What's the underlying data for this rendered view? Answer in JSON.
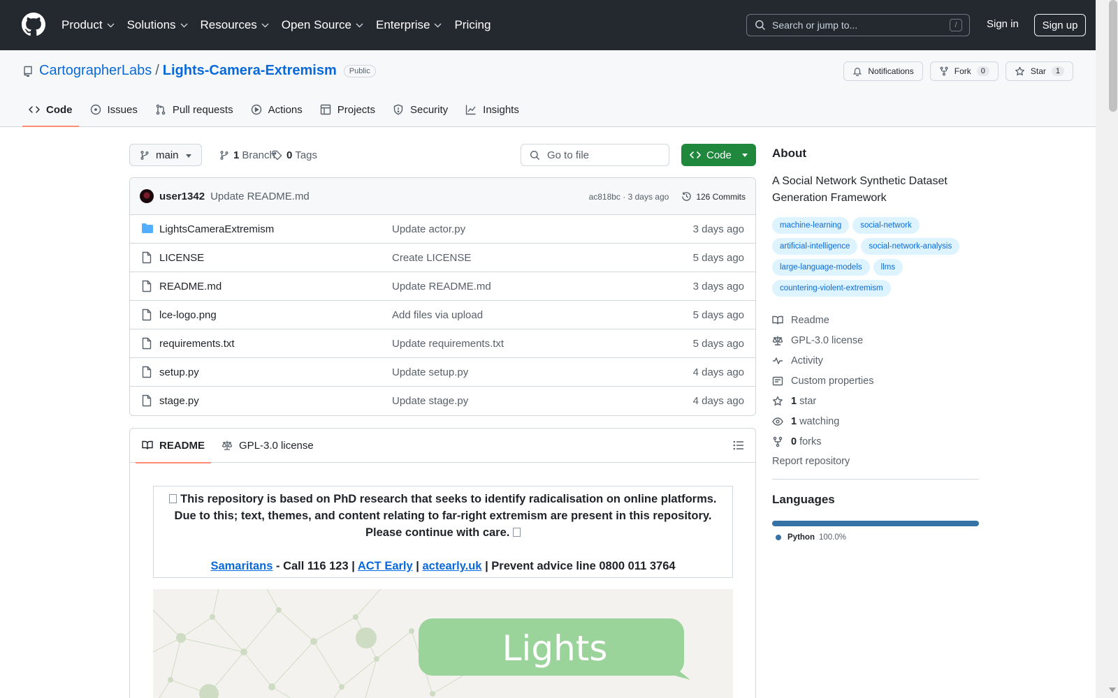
{
  "header": {
    "nav": [
      {
        "label": "Product",
        "dropdown": true
      },
      {
        "label": "Solutions",
        "dropdown": true
      },
      {
        "label": "Resources",
        "dropdown": true
      },
      {
        "label": "Open Source",
        "dropdown": true
      },
      {
        "label": "Enterprise",
        "dropdown": true
      },
      {
        "label": "Pricing",
        "dropdown": false
      }
    ],
    "search_placeholder": "Search or jump to...",
    "search_shortcut": "/",
    "sign_in": "Sign in",
    "sign_up": "Sign up"
  },
  "repo": {
    "owner": "CartographerLabs",
    "separator": "/",
    "name": "Lights-Camera-Extremism",
    "visibility": "Public",
    "buttons": {
      "notifications": "Notifications",
      "fork": "Fork",
      "fork_count": "0",
      "star": "Star",
      "star_count": "1"
    },
    "tabs": [
      {
        "label": "Code",
        "icon": "code-icon",
        "active": true
      },
      {
        "label": "Issues",
        "icon": "issue-icon",
        "active": false
      },
      {
        "label": "Pull requests",
        "icon": "pull-request-icon",
        "active": false
      },
      {
        "label": "Actions",
        "icon": "play-icon",
        "active": false
      },
      {
        "label": "Projects",
        "icon": "table-icon",
        "active": false
      },
      {
        "label": "Security",
        "icon": "shield-icon",
        "active": false
      },
      {
        "label": "Insights",
        "icon": "graph-icon",
        "active": false
      }
    ]
  },
  "toolbar": {
    "branch": "main",
    "branch_count": "1",
    "branch_label": "Branch",
    "tag_count": "0",
    "tag_label": "Tags",
    "go_to_file": "Go to file",
    "code_button": "Code"
  },
  "commit": {
    "user": "user1342",
    "message": "Update README.md",
    "sha_time": "ac818bc · 3 days ago",
    "commits": "126 Commits"
  },
  "files": [
    {
      "name": "LightsCameraExtremism",
      "type": "folder",
      "message": "Update actor.py",
      "time": "3 days ago"
    },
    {
      "name": "LICENSE",
      "type": "file",
      "message": "Create LICENSE",
      "time": "5 days ago"
    },
    {
      "name": "README.md",
      "type": "file",
      "message": "Update README.md",
      "time": "3 days ago"
    },
    {
      "name": "lce-logo.png",
      "type": "file",
      "message": "Add files via upload",
      "time": "5 days ago"
    },
    {
      "name": "requirements.txt",
      "type": "file",
      "message": "Update requirements.txt",
      "time": "5 days ago"
    },
    {
      "name": "setup.py",
      "type": "file",
      "message": "Update setup.py",
      "time": "4 days ago"
    },
    {
      "name": "stage.py",
      "type": "file",
      "message": "Update stage.py",
      "time": "4 days ago"
    }
  ],
  "readme": {
    "tabs": {
      "readme": "README",
      "license": "GPL-3.0 license"
    },
    "warning": "This repository is based on PhD research that seeks to identify radicalisation on online platforms. Due to this; text, themes, and content relating to far-right extremism are present in this repository. Please continue with care.",
    "links": {
      "samaritans": "Samaritans",
      "samaritans_text": " - Call 116 123 | ",
      "act_early": "ACT Early",
      "pipe": " | ",
      "actearly_uk": "actearly.uk",
      "prevent_text": " | Prevent advice line 0800 011 3764"
    },
    "banner_text": "Lights"
  },
  "about": {
    "heading": "About",
    "description": "A Social Network Synthetic Dataset Generation Framework",
    "topics": [
      "machine-learning",
      "social-network",
      "artificial-intelligence",
      "social-network-analysis",
      "large-language-models",
      "llms",
      "countering-violent-extremism"
    ],
    "items": [
      {
        "icon": "book-icon",
        "count": "",
        "label": "Readme"
      },
      {
        "icon": "law-icon",
        "count": "",
        "label": "GPL-3.0 license"
      },
      {
        "icon": "pulse-icon",
        "count": "",
        "label": "Activity"
      },
      {
        "icon": "note-icon",
        "count": "",
        "label": "Custom properties"
      },
      {
        "icon": "star-icon",
        "count": "1",
        "label": "star"
      },
      {
        "icon": "eye-icon",
        "count": "1",
        "label": "watching"
      },
      {
        "icon": "fork-icon",
        "count": "0",
        "label": "forks"
      }
    ],
    "report": "Report repository"
  },
  "languages": {
    "heading": "Languages",
    "items": [
      {
        "name": "Python",
        "percent": "100.0%",
        "color": "#3572a5"
      }
    ]
  },
  "colors": {
    "header_bg": "#24292f",
    "link": "#0969da",
    "code_button": "#1f883d",
    "tab_underline": "#fd8c73",
    "topic_bg": "#ddf4ff",
    "banner_bubble": "#9bd49b"
  }
}
